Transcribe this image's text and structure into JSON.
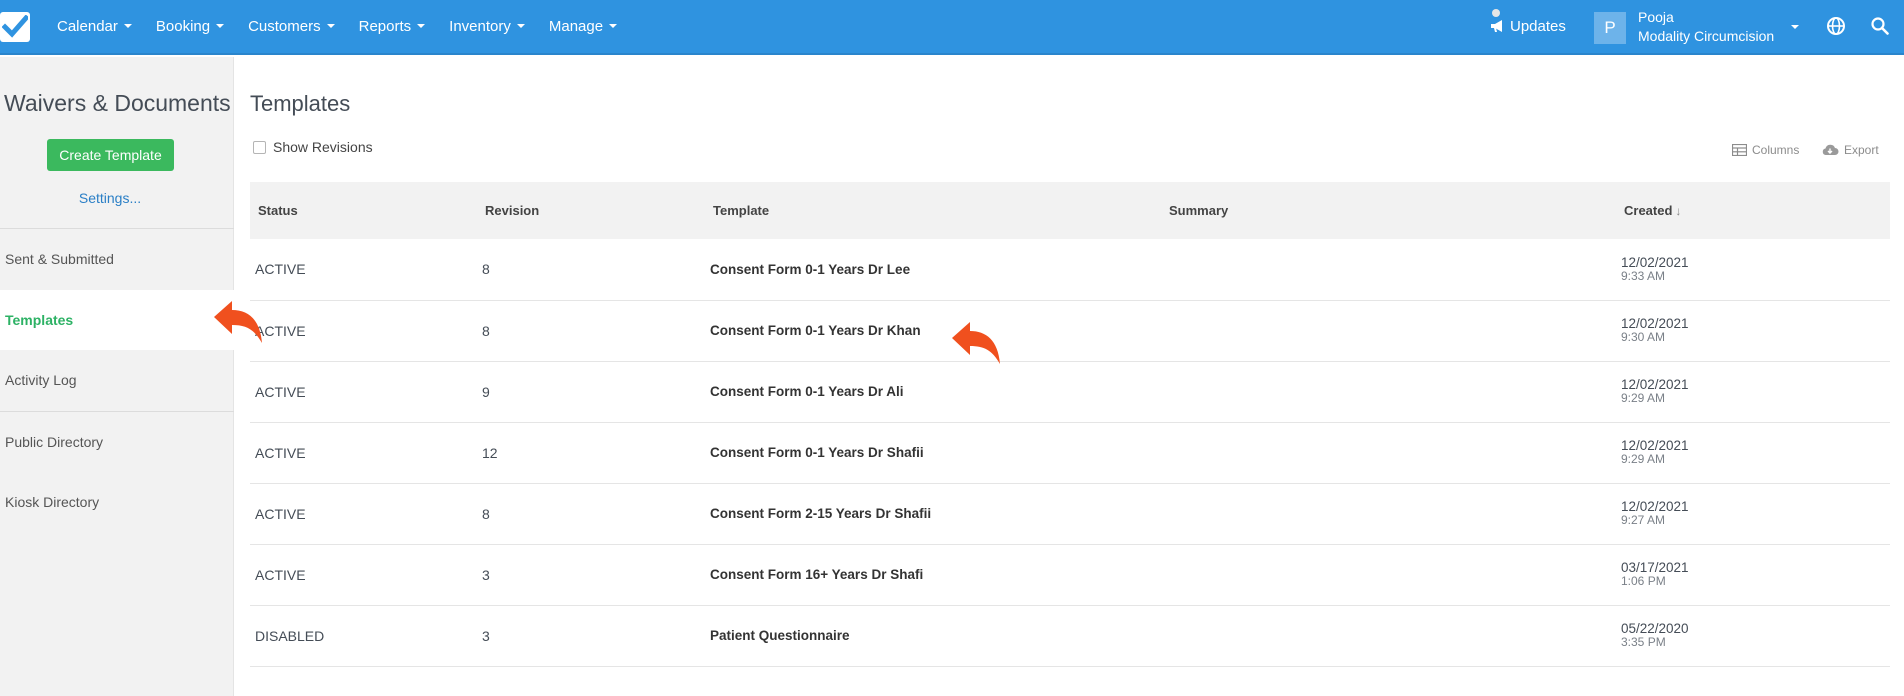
{
  "nav": {
    "items": [
      "Calendar",
      "Booking",
      "Customers",
      "Reports",
      "Inventory",
      "Manage"
    ],
    "updates_label": "Updates",
    "user": {
      "initial": "P",
      "name": "Pooja",
      "company": "Modality Circumcision"
    }
  },
  "sidebar": {
    "title": "Waivers & Documents",
    "create_button": "Create Template",
    "settings_link": "Settings...",
    "items": [
      {
        "label": "Sent & Submitted",
        "active": false
      },
      {
        "label": "Templates",
        "active": true
      },
      {
        "label": "Activity Log",
        "active": false
      },
      {
        "label": "Public Directory",
        "active": false
      },
      {
        "label": "Kiosk Directory",
        "active": false
      }
    ]
  },
  "main": {
    "title": "Templates",
    "show_revisions_label": "Show Revisions",
    "columns_button": "Columns",
    "export_button": "Export",
    "table": {
      "headers": {
        "status": "Status",
        "revision": "Revision",
        "template": "Template",
        "summary": "Summary",
        "created": "Created"
      },
      "sort_indicator": "↓",
      "rows": [
        {
          "status": "ACTIVE",
          "revision": "8",
          "template": "Consent Form 0-1 Years Dr Lee",
          "summary": "",
          "date": "12/02/2021",
          "time": "9:33 AM"
        },
        {
          "status": "ACTIVE",
          "revision": "8",
          "template": "Consent Form 0-1 Years Dr Khan",
          "summary": "",
          "date": "12/02/2021",
          "time": "9:30 AM"
        },
        {
          "status": "ACTIVE",
          "revision": "9",
          "template": "Consent Form 0-1 Years Dr Ali",
          "summary": "",
          "date": "12/02/2021",
          "time": "9:29 AM"
        },
        {
          "status": "ACTIVE",
          "revision": "12",
          "template": "Consent Form 0-1 Years Dr Shafii",
          "summary": "",
          "date": "12/02/2021",
          "time": "9:29 AM"
        },
        {
          "status": "ACTIVE",
          "revision": "8",
          "template": "Consent Form 2-15 Years Dr Shafii",
          "summary": "",
          "date": "12/02/2021",
          "time": "9:27 AM"
        },
        {
          "status": "ACTIVE",
          "revision": "3",
          "template": "Consent Form 16+ Years Dr Shafi",
          "summary": "",
          "date": "03/17/2021",
          "time": "1:06 PM"
        },
        {
          "status": "DISABLED",
          "revision": "3",
          "template": "Patient Questionnaire",
          "summary": "",
          "date": "05/22/2020",
          "time": "3:35 PM"
        }
      ]
    }
  },
  "colors": {
    "navbar": "#2f93e0",
    "create_button": "#3bb95e",
    "active_sidebar_text": "#2db265",
    "annotation_arrow": "#f0501e",
    "link": "#2a7fc6"
  },
  "icons": [
    "checkmark-logo-icon",
    "megaphone-icon",
    "globe-icon",
    "search-icon",
    "columns-icon",
    "cloud-download-icon",
    "curved-arrow-annotation-icon"
  ]
}
